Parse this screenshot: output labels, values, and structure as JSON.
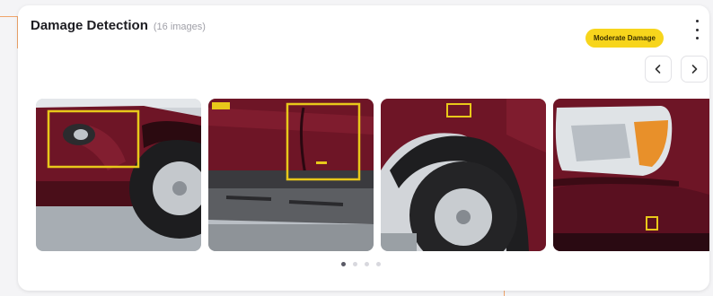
{
  "widget": {
    "title": "Damage Detection",
    "subtitle": "(16 images)",
    "badge": "Moderate Damage",
    "badge_color": "#f7d51c"
  },
  "icons": {
    "menu": "more-vertical-icon",
    "prev": "chevron-left-icon",
    "next": "chevron-right-icon"
  },
  "carousel": {
    "images": [
      {
        "name": "front bumper and wheel damage photo"
      },
      {
        "name": "side door dent photo"
      },
      {
        "name": "rear wheel arch photo"
      },
      {
        "name": "headlight and bumper photo"
      }
    ],
    "total_pages": 4,
    "active_page": 1
  },
  "colors": {
    "car_paint": "#6e1526",
    "detection_box": "#e8c81a",
    "accent_line": "#f0a46a"
  }
}
